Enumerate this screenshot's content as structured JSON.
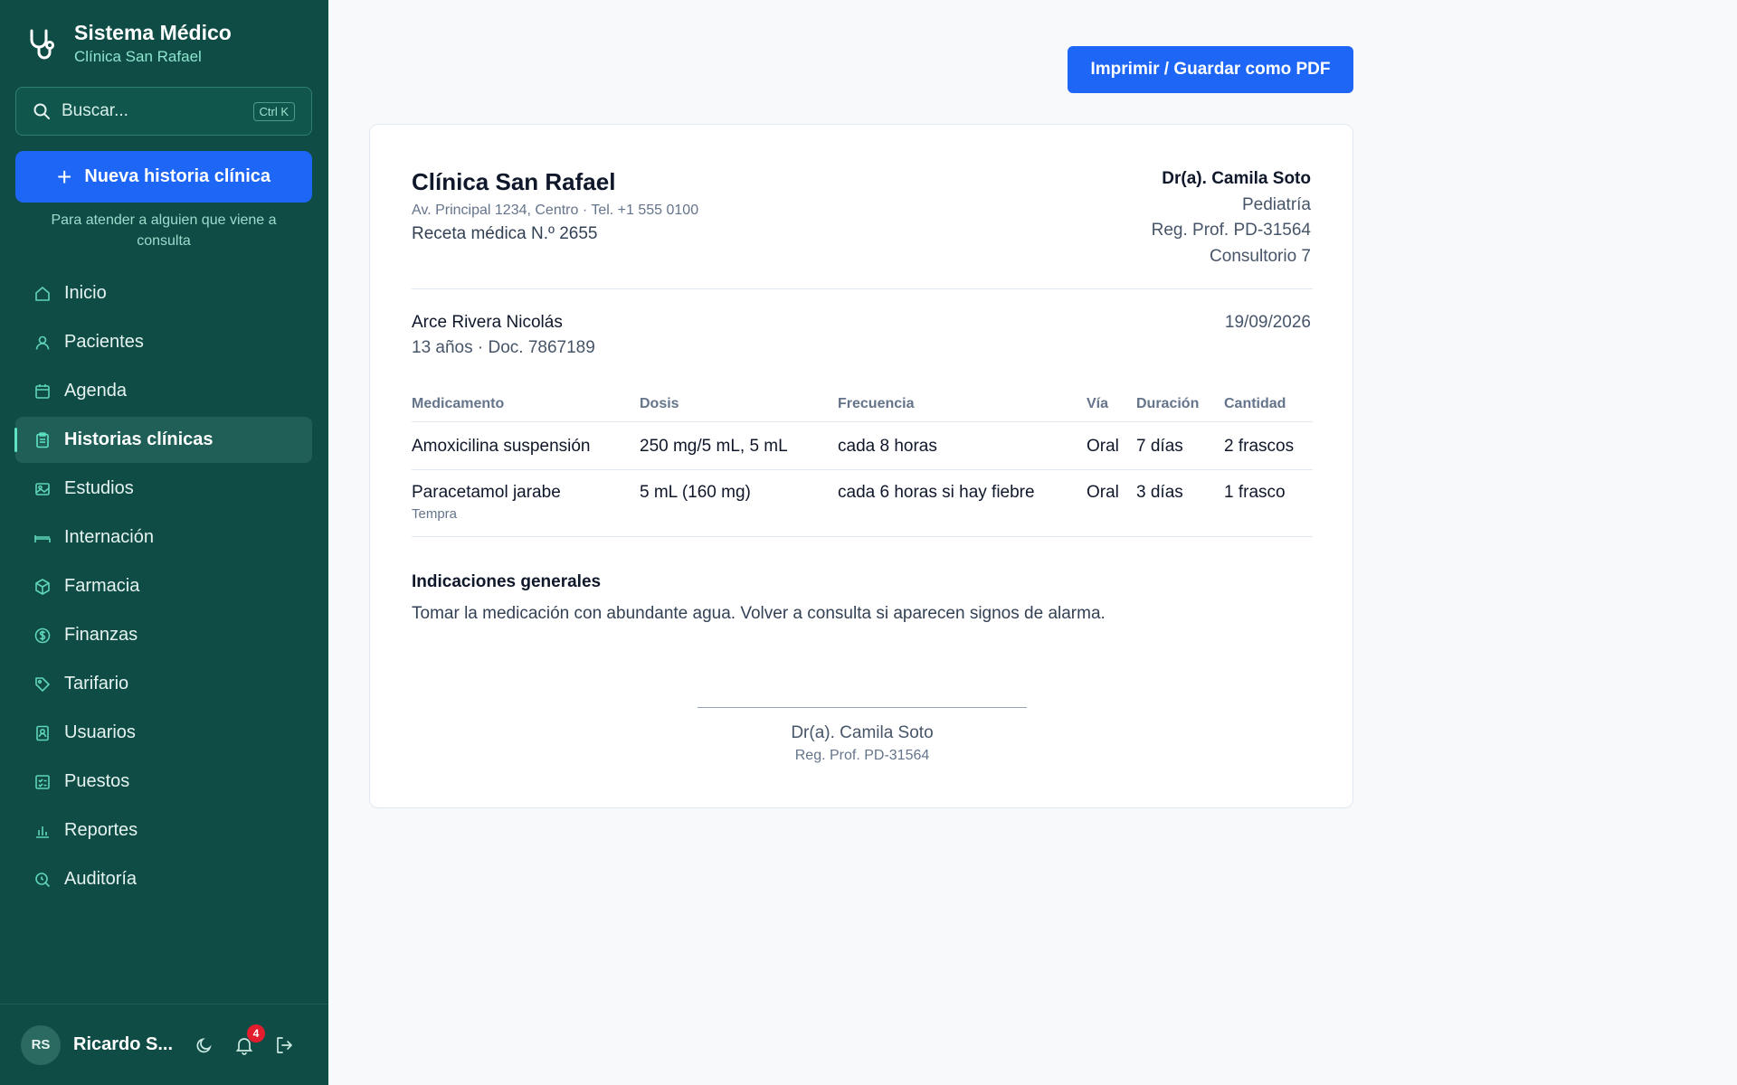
{
  "app": {
    "title": "Sistema Médico",
    "clinic": "Clínica San Rafael"
  },
  "sidebar": {
    "search_placeholder": "Buscar...",
    "search_shortcut": "Ctrl K",
    "new_button": "Nueva historia clínica",
    "new_hint": "Para atender a alguien que viene a consulta",
    "items": [
      {
        "label": "Inicio",
        "icon": "home-icon"
      },
      {
        "label": "Pacientes",
        "icon": "user-icon"
      },
      {
        "label": "Agenda",
        "icon": "calendar-icon"
      },
      {
        "label": "Historias clínicas",
        "icon": "clipboard-icon",
        "active": true
      },
      {
        "label": "Estudios",
        "icon": "image-icon"
      },
      {
        "label": "Internación",
        "icon": "bed-icon"
      },
      {
        "label": "Farmacia",
        "icon": "box-icon"
      },
      {
        "label": "Finanzas",
        "icon": "dollar-icon"
      },
      {
        "label": "Tarifario",
        "icon": "tag-icon"
      },
      {
        "label": "Usuarios",
        "icon": "id-card-icon"
      },
      {
        "label": "Puestos",
        "icon": "list-check-icon"
      },
      {
        "label": "Reportes",
        "icon": "bar-chart-icon"
      },
      {
        "label": "Auditoría",
        "icon": "search-doc-icon"
      }
    ],
    "user": {
      "initials": "RS",
      "name": "Ricardo S...",
      "notifications": "4"
    }
  },
  "toolbar": {
    "print_label": "Imprimir / Guardar como PDF"
  },
  "prescription": {
    "clinic_name": "Clínica San Rafael",
    "address": "Av. Principal 1234, Centro · Tel. +1 555 0100",
    "number": "Receta médica N.º 2655",
    "doctor": {
      "name": "Dr(a). Camila Soto",
      "specialty": "Pediatría",
      "registration": "Reg. Prof. PD-31564",
      "office": "Consultorio 7"
    },
    "patient": {
      "name": "Arce Rivera Nicolás",
      "info": "13 años · Doc. 7867189",
      "date": "19/09/2026"
    },
    "columns": [
      "Medicamento",
      "Dosis",
      "Frecuencia",
      "Vía",
      "Duración",
      "Cantidad"
    ],
    "medications": [
      {
        "name": "Amoxicilina suspensión",
        "brand": "",
        "dose": "250 mg/5 mL, 5 mL",
        "frequency": "cada 8 horas",
        "route": "Oral",
        "duration": "7 días",
        "quantity": "2 frascos"
      },
      {
        "name": "Paracetamol jarabe",
        "brand": "Tempra",
        "dose": "5 mL (160 mg)",
        "frequency": "cada 6 horas si hay fiebre",
        "route": "Oral",
        "duration": "3 días",
        "quantity": "1 frasco"
      }
    ],
    "instructions_title": "Indicaciones generales",
    "instructions": "Tomar la medicación con abundante agua. Volver a consulta si aparecen signos de alarma.",
    "signature": {
      "name": "Dr(a). Camila Soto",
      "registration": "Reg. Prof. PD-31564"
    }
  },
  "colors": {
    "sidebar_bg": "#0f4c45",
    "accent": "#1e66f5",
    "badge": "#e11d2e"
  }
}
